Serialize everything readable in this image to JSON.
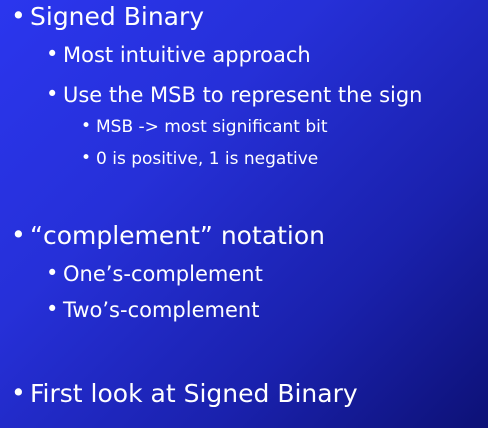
{
  "slide": {
    "bullet_glyph": "•",
    "items": [
      {
        "level": 1,
        "text": "Signed Binary"
      },
      {
        "level": 2,
        "text": "Most intuitive approach"
      },
      {
        "level": 2,
        "text": "Use the MSB to represent the sign"
      },
      {
        "level": 3,
        "text": "MSB -> most significant bit"
      },
      {
        "level": 3,
        "text": "0 is positive, 1 is negative"
      },
      {
        "level": 1,
        "text": "“complement” notation"
      },
      {
        "level": 2,
        "text": "One’s-complement"
      },
      {
        "level": 2,
        "text": "Two’s-complement"
      },
      {
        "level": 1,
        "text": "First look at Signed Binary"
      }
    ],
    "colors": {
      "background_top": "#2b36ee",
      "background_bottom": "#0d1176",
      "text": "#ffffff"
    }
  }
}
